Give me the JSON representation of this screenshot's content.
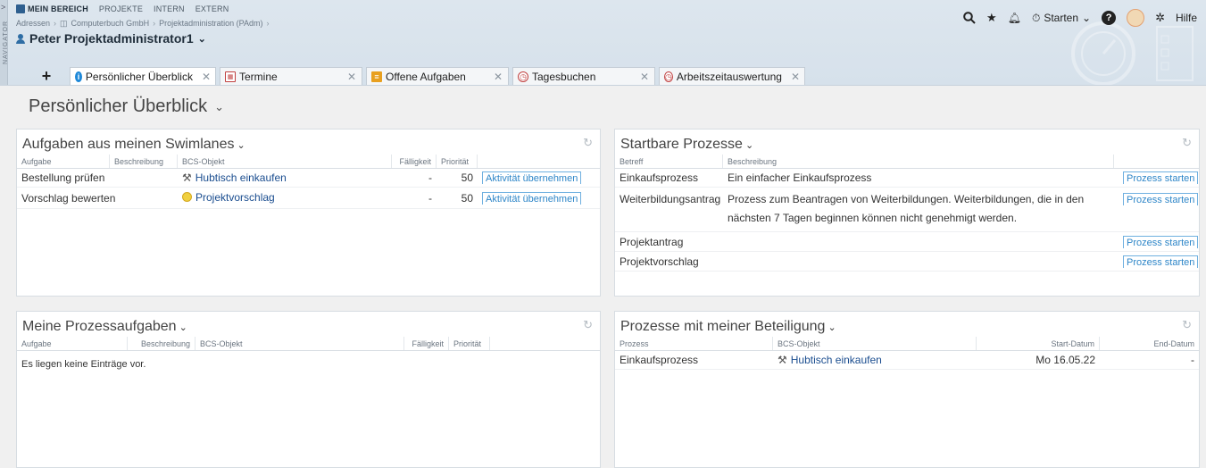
{
  "topnav": {
    "items": [
      {
        "label": "MEIN BEREICH",
        "active": true
      },
      {
        "label": "PROJEKTE",
        "active": false
      },
      {
        "label": "INTERN",
        "active": false
      },
      {
        "label": "EXTERN",
        "active": false
      }
    ]
  },
  "navigator_label": "NAVIGATOR",
  "breadcrumb": [
    "Adressen",
    "Computerbuch GmbH",
    "Projektadministration (PAdm)"
  ],
  "context_user": "Peter Projektadministrator1",
  "tabs": {
    "add_label": "+",
    "items": [
      {
        "label": "Persönlicher Überblick",
        "icon": "info-icon"
      },
      {
        "label": "Termine",
        "icon": "calendar-icon"
      },
      {
        "label": "Offene Aufgaben",
        "icon": "tasks-icon"
      },
      {
        "label": "Tagesbuchen",
        "icon": "clock-icon"
      },
      {
        "label": "Arbeitszeitauswertung",
        "icon": "clock-icon"
      }
    ]
  },
  "toolbar": {
    "start_label": "Starten",
    "help_label": "Hilfe"
  },
  "page_title": "Persönlicher Überblick",
  "panels": {
    "swimlanes": {
      "title": "Aufgaben aus meinen Swimlanes",
      "columns": [
        "Aufgabe",
        "Beschreibung",
        "BCS-Objekt",
        "Fälligkeit",
        "Priorität",
        ""
      ],
      "rows": [
        {
          "aufgabe": "Bestellung prüfen",
          "beschreibung": "",
          "objekt": "Hubtisch einkaufen",
          "objekt_icon": "tool-icon",
          "faelligkeit": "-",
          "prioritaet": "50",
          "action": "Aktivität übernehmen"
        },
        {
          "aufgabe": "Vorschlag bewerten",
          "beschreibung": "",
          "objekt": "Projektvorschlag",
          "objekt_icon": "lightbulb-icon",
          "faelligkeit": "-",
          "prioritaet": "50",
          "action": "Aktivität übernehmen"
        }
      ]
    },
    "startbar": {
      "title": "Startbare Prozesse",
      "columns": [
        "Betreff",
        "Beschreibung",
        ""
      ],
      "rows": [
        {
          "betreff": "Einkaufsprozess",
          "beschreibung": "Ein einfacher Einkaufsprozess",
          "action": "Prozess starten"
        },
        {
          "betreff": "Weiterbildungsantrag",
          "beschreibung": "Prozess zum Beantragen von Weiterbildungen. Weiterbildungen, die in den nächsten 7 Tagen beginnen können nicht genehmigt werden.",
          "action": "Prozess starten"
        },
        {
          "betreff": "Projektantrag",
          "beschreibung": "",
          "action": "Prozess starten"
        },
        {
          "betreff": "Projektvorschlag",
          "beschreibung": "",
          "action": "Prozess starten"
        }
      ]
    },
    "prozessaufgaben": {
      "title": "Meine Prozessaufgaben",
      "columns": [
        "Aufgabe",
        "Beschreibung",
        "BCS-Objekt",
        "Fälligkeit",
        "Priorität",
        ""
      ],
      "empty": "Es liegen keine Einträge vor."
    },
    "beteiligung": {
      "title": "Prozesse mit meiner Beteiligung",
      "columns": [
        "Prozess",
        "BCS-Objekt",
        "Start-Datum",
        "End-Datum"
      ],
      "rows": [
        {
          "prozess": "Einkaufsprozess",
          "objekt": "Hubtisch einkaufen",
          "objekt_icon": "tool-icon",
          "start": "Mo 16.05.22",
          "end": "-"
        }
      ]
    }
  }
}
